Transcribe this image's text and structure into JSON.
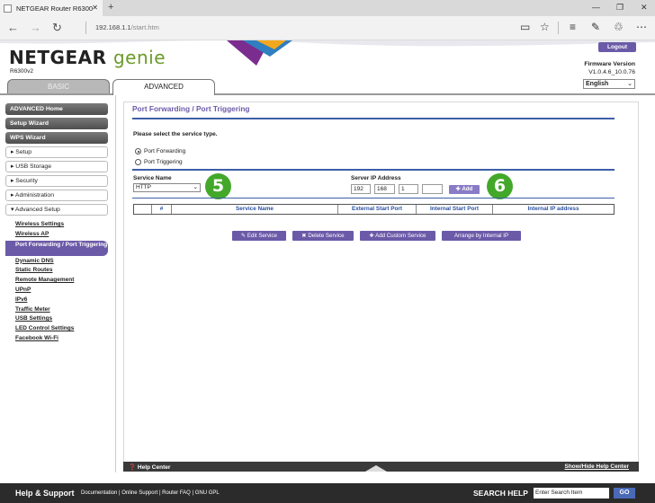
{
  "browser": {
    "tab_title": "NETGEAR Router R6300",
    "url_host": "192.168.1.1",
    "url_path": "/start.htm"
  },
  "header": {
    "logo_brand": "NETGEAR",
    "logo_product": "genie",
    "model": "R6300v2",
    "logout": "Logout",
    "firmware_label": "Firmware Version",
    "firmware_version": "V1.0.4.6_10.0.76",
    "language": "English"
  },
  "main_tabs": {
    "basic": "BASIC",
    "advanced": "ADVANCED"
  },
  "sidebar": {
    "dark_items": [
      "ADVANCED Home",
      "Setup Wizard",
      "WPS Wizard"
    ],
    "sections": [
      "▸ Setup",
      "▸ USB Storage",
      "▸ Security",
      "▸ Administration",
      "▾ Advanced Setup"
    ],
    "sub_items": [
      "Wireless Settings",
      "Wireless AP",
      "Port Forwarding / Port Triggering",
      "Dynamic DNS",
      "Static Routes",
      "Remote Management",
      "UPnP",
      "IPv6",
      "Traffic Meter",
      "USB Settings",
      "LED Control Settings",
      "Facebook Wi-Fi"
    ]
  },
  "page": {
    "title": "Port Forwarding / Port Triggering",
    "service_type_prompt": "Please select the service type.",
    "radio_forwarding": "Port Forwarding",
    "radio_triggering": "Port Triggering",
    "service_name_label": "Service Name",
    "service_name_value": "HTTP",
    "server_ip_label": "Server IP Address",
    "ip": [
      "192",
      "168",
      "1",
      ""
    ],
    "add_button": "✚ Add",
    "badge_5": "5",
    "badge_6": "6",
    "table_headers": [
      "",
      "#",
      "Service Name",
      "External Start Port",
      "Internal Start Port",
      "Internal IP address"
    ],
    "edit_button": "✎ Edit Service",
    "delete_button": "✖ Delete Service",
    "add_custom_button": "✚ Add Custom Service",
    "arrange_button": "Arrange by Internal IP"
  },
  "helpbar": {
    "help_center": "❓ Help Center",
    "show_hide": "Show/Hide Help Center"
  },
  "footer": {
    "help_support": "Help & Support",
    "links": "Documentation | Online Support | Router FAQ | GNU GPL",
    "search_label": "SEARCH HELP",
    "search_placeholder": "Enter Search Item",
    "go": "GO"
  }
}
